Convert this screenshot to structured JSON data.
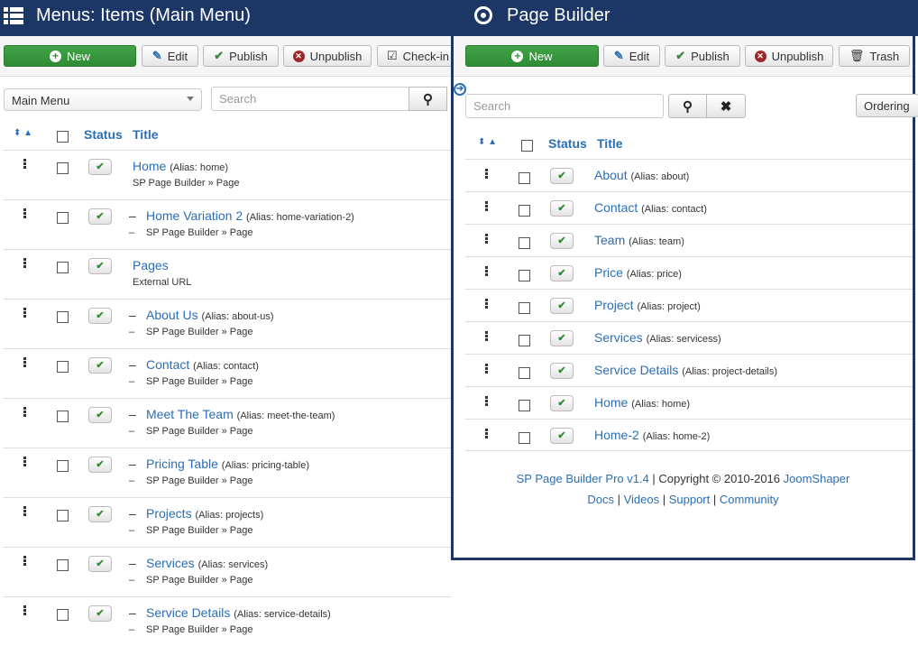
{
  "left": {
    "title": "Menus: Items (Main Menu)",
    "toolbar": {
      "new": "New",
      "edit": "Edit",
      "publish": "Publish",
      "unpublish": "Unpublish",
      "checkin": "Check-in"
    },
    "menu_select": "Main Menu",
    "search_placeholder": "Search",
    "headers": {
      "status": "Status",
      "title": "Title"
    },
    "items": [
      {
        "title": "Home",
        "alias": "(Alias: home)",
        "type": "SP Page Builder » Page",
        "indent": ""
      },
      {
        "title": "Home Variation 2",
        "alias": "(Alias: home-variation-2)",
        "type": "SP Page Builder » Page",
        "indent": "–"
      },
      {
        "title": "Pages",
        "alias": "",
        "type": "External URL",
        "indent": ""
      },
      {
        "title": "About Us",
        "alias": "(Alias: about-us)",
        "type": "SP Page Builder » Page",
        "indent": "–"
      },
      {
        "title": "Contact",
        "alias": "(Alias: contact)",
        "type": "SP Page Builder » Page",
        "indent": "–"
      },
      {
        "title": "Meet The Team",
        "alias": "(Alias: meet-the-team)",
        "type": "SP Page Builder » Page",
        "indent": "–"
      },
      {
        "title": "Pricing Table",
        "alias": "(Alias: pricing-table)",
        "type": "SP Page Builder » Page",
        "indent": "–"
      },
      {
        "title": "Projects",
        "alias": "(Alias: projects)",
        "type": "SP Page Builder » Page",
        "indent": "–"
      },
      {
        "title": "Services",
        "alias": "(Alias: services)",
        "type": "SP Page Builder » Page",
        "indent": "–"
      },
      {
        "title": "Service Details",
        "alias": "(Alias: service-details)",
        "type": "SP Page Builder » Page",
        "indent": "–"
      }
    ]
  },
  "right": {
    "title": "Page Builder",
    "toolbar": {
      "new": "New",
      "edit": "Edit",
      "publish": "Publish",
      "unpublish": "Unpublish",
      "trash": "Trash"
    },
    "search_placeholder": "Search",
    "ordering": "Ordering",
    "headers": {
      "status": "Status",
      "title": "Title"
    },
    "items": [
      {
        "title": "About",
        "alias": "(Alias: about)"
      },
      {
        "title": "Contact",
        "alias": "(Alias: contact)"
      },
      {
        "title": "Team",
        "alias": "(Alias: team)"
      },
      {
        "title": "Price",
        "alias": "(Alias: price)"
      },
      {
        "title": "Project",
        "alias": "(Alias: project)"
      },
      {
        "title": "Services",
        "alias": "(Alias: servicess)"
      },
      {
        "title": "Service Details",
        "alias": "(Alias: project-details)"
      },
      {
        "title": "Home",
        "alias": "(Alias: home)"
      },
      {
        "title": "Home-2",
        "alias": "(Alias: home-2)"
      }
    ],
    "footer": {
      "product": "SP Page Builder Pro v1.4",
      "copyright": " | Copyright © 2010-2016 ",
      "company": "JoomShaper",
      "docs": "Docs",
      "videos": "Videos",
      "support": "Support",
      "community": "Community",
      "sep": " | "
    }
  }
}
